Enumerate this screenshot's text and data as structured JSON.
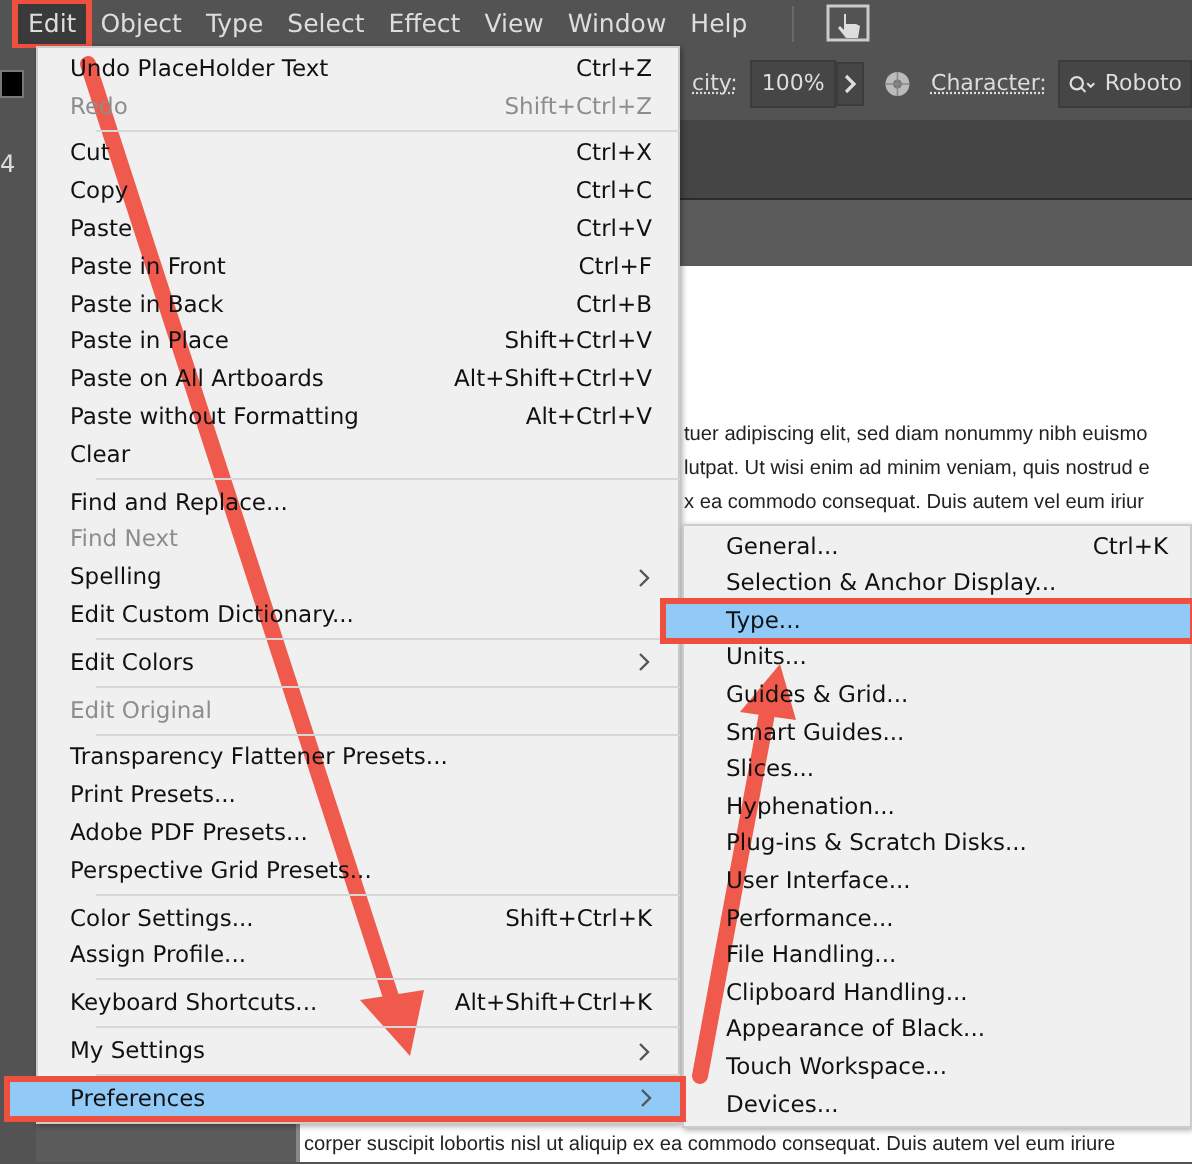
{
  "menu_bar": {
    "items": [
      {
        "label": "Edit",
        "selected": true
      },
      {
        "label": "Object",
        "selected": false
      },
      {
        "label": "Type",
        "selected": false
      },
      {
        "label": "Select",
        "selected": false
      },
      {
        "label": "Effect",
        "selected": false
      },
      {
        "label": "View",
        "selected": false
      },
      {
        "label": "Window",
        "selected": false
      },
      {
        "label": "Help",
        "selected": false
      }
    ]
  },
  "left_panel": {
    "text": "4"
  },
  "toolbar": {
    "opacity_label": "city:",
    "opacity_value": "100%",
    "character_label": "Character:",
    "font_value": "Roboto"
  },
  "document": {
    "lines": [
      "tuer adipiscing elit, sed diam nonummy nibh euismo",
      "lutpat. Ut wisi enim ad minim veniam, quis nostrud e",
      "x ea commodo consequat. Duis autem vel eum iriur"
    ],
    "bottom_line": "corper suscipit lobortis nisl ut aliquip ex ea commodo consequat. Duis autem vel eum iriure"
  },
  "edit_menu": {
    "items": [
      {
        "kind": "item",
        "label": "Undo PlaceHolder Text",
        "shortcut": "Ctrl+Z",
        "disabled": false,
        "submenu": false,
        "selected": false
      },
      {
        "kind": "item",
        "label": "Redo",
        "shortcut": "Shift+Ctrl+Z",
        "disabled": true,
        "submenu": false,
        "selected": false
      },
      {
        "kind": "separator"
      },
      {
        "kind": "item",
        "label": "Cut",
        "shortcut": "Ctrl+X",
        "disabled": false,
        "submenu": false,
        "selected": false
      },
      {
        "kind": "item",
        "label": "Copy",
        "shortcut": "Ctrl+C",
        "disabled": false,
        "submenu": false,
        "selected": false
      },
      {
        "kind": "item",
        "label": "Paste",
        "shortcut": "Ctrl+V",
        "disabled": false,
        "submenu": false,
        "selected": false
      },
      {
        "kind": "item",
        "label": "Paste in Front",
        "shortcut": "Ctrl+F",
        "disabled": false,
        "submenu": false,
        "selected": false
      },
      {
        "kind": "item",
        "label": "Paste in Back",
        "shortcut": "Ctrl+B",
        "disabled": false,
        "submenu": false,
        "selected": false
      },
      {
        "kind": "item",
        "label": "Paste in Place",
        "shortcut": "Shift+Ctrl+V",
        "disabled": false,
        "submenu": false,
        "selected": false
      },
      {
        "kind": "item",
        "label": "Paste on All Artboards",
        "shortcut": "Alt+Shift+Ctrl+V",
        "disabled": false,
        "submenu": false,
        "selected": false
      },
      {
        "kind": "item",
        "label": "Paste without Formatting",
        "shortcut": "Alt+Ctrl+V",
        "disabled": false,
        "submenu": false,
        "selected": false
      },
      {
        "kind": "item",
        "label": "Clear",
        "disabled": false,
        "submenu": false,
        "selected": false
      },
      {
        "kind": "separator"
      },
      {
        "kind": "item",
        "label": "Find and Replace...",
        "disabled": false,
        "submenu": false,
        "selected": false
      },
      {
        "kind": "item",
        "label": "Find Next",
        "disabled": true,
        "submenu": false,
        "selected": false
      },
      {
        "kind": "item",
        "label": "Spelling",
        "disabled": false,
        "submenu": true,
        "selected": false
      },
      {
        "kind": "item",
        "label": "Edit Custom Dictionary...",
        "disabled": false,
        "submenu": false,
        "selected": false
      },
      {
        "kind": "separator"
      },
      {
        "kind": "item",
        "label": "Edit Colors",
        "disabled": false,
        "submenu": true,
        "selected": false
      },
      {
        "kind": "separator"
      },
      {
        "kind": "item",
        "label": "Edit Original",
        "disabled": true,
        "submenu": false,
        "selected": false
      },
      {
        "kind": "separator"
      },
      {
        "kind": "item",
        "label": "Transparency Flattener Presets...",
        "disabled": false,
        "submenu": false,
        "selected": false
      },
      {
        "kind": "item",
        "label": "Print Presets...",
        "disabled": false,
        "submenu": false,
        "selected": false
      },
      {
        "kind": "item",
        "label": "Adobe PDF Presets...",
        "disabled": false,
        "submenu": false,
        "selected": false
      },
      {
        "kind": "item",
        "label": "Perspective Grid Presets...",
        "disabled": false,
        "submenu": false,
        "selected": false
      },
      {
        "kind": "separator"
      },
      {
        "kind": "item",
        "label": "Color Settings...",
        "shortcut": "Shift+Ctrl+K",
        "disabled": false,
        "submenu": false,
        "selected": false
      },
      {
        "kind": "item",
        "label": "Assign Profile...",
        "disabled": false,
        "submenu": false,
        "selected": false
      },
      {
        "kind": "separator"
      },
      {
        "kind": "item",
        "label": "Keyboard Shortcuts...",
        "shortcut": "Alt+Shift+Ctrl+K",
        "disabled": false,
        "submenu": false,
        "selected": false
      },
      {
        "kind": "separator"
      },
      {
        "kind": "item",
        "label": "My Settings",
        "disabled": false,
        "submenu": true,
        "selected": false
      },
      {
        "kind": "separator"
      },
      {
        "kind": "item",
        "label": "Preferences",
        "disabled": false,
        "submenu": true,
        "selected": true
      }
    ]
  },
  "preferences_submenu": {
    "items": [
      {
        "kind": "item",
        "label": "General...",
        "shortcut": "Ctrl+K",
        "selected": false
      },
      {
        "kind": "item",
        "label": "Selection & Anchor Display...",
        "selected": false
      },
      {
        "kind": "item",
        "label": "Type...",
        "selected": true
      },
      {
        "kind": "item",
        "label": "Units...",
        "selected": false
      },
      {
        "kind": "item",
        "label": "Guides & Grid...",
        "selected": false
      },
      {
        "kind": "item",
        "label": "Smart Guides...",
        "selected": false
      },
      {
        "kind": "item",
        "label": "Slices...",
        "selected": false
      },
      {
        "kind": "item",
        "label": "Hyphenation...",
        "selected": false
      },
      {
        "kind": "item",
        "label": "Plug-ins & Scratch Disks...",
        "selected": false
      },
      {
        "kind": "item",
        "label": "User Interface...",
        "selected": false
      },
      {
        "kind": "item",
        "label": "Performance...",
        "selected": false
      },
      {
        "kind": "item",
        "label": "File Handling...",
        "selected": false
      },
      {
        "kind": "item",
        "label": "Clipboard Handling...",
        "selected": false
      },
      {
        "kind": "item",
        "label": "Appearance of Black...",
        "selected": false
      },
      {
        "kind": "item",
        "label": "Touch Workspace...",
        "selected": false
      },
      {
        "kind": "item",
        "label": "Devices...",
        "selected": false
      }
    ]
  }
}
